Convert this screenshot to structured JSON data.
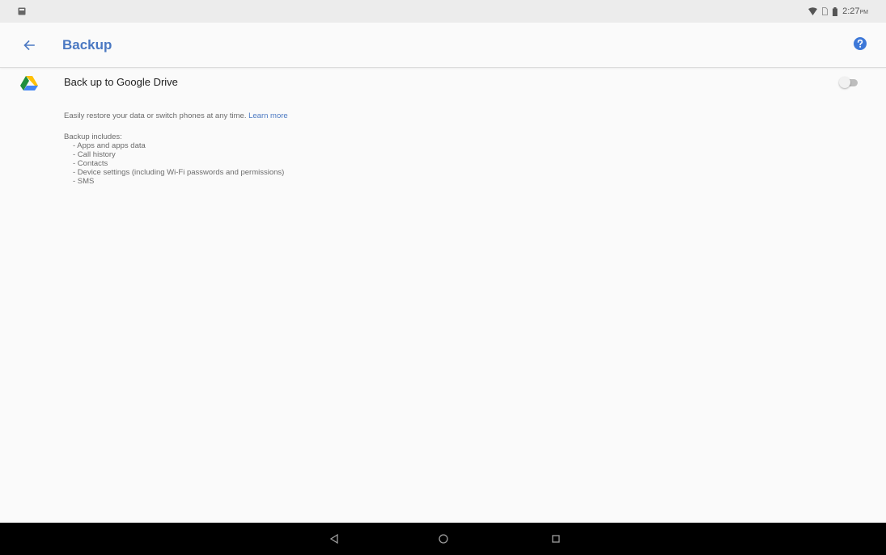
{
  "status_bar": {
    "time": "2:27",
    "time_suffix": "PM",
    "icons": [
      "notification-icon",
      "wifi-icon",
      "sim-icon",
      "battery-icon"
    ]
  },
  "toolbar": {
    "title": "Backup",
    "back_icon": "arrow-back-icon",
    "help_icon": "help-icon"
  },
  "backup_setting": {
    "icon": "google-drive-icon",
    "title": "Back up to Google Drive",
    "toggle_on": false,
    "description": "Easily restore your data or switch phones at any time.",
    "learn_more": "Learn more",
    "includes_header": "Backup includes:",
    "includes": [
      "- Apps and apps data",
      "- Call history",
      "- Contacts",
      "- Device settings (including Wi-Fi passwords and permissions)",
      "- SMS"
    ]
  },
  "colors": {
    "accent": "#4a78c2",
    "background": "#fafafa",
    "status_bar": "#ececec",
    "nav_bar": "#000000"
  },
  "nav_bar": {
    "buttons": [
      "back-triangle-icon",
      "home-circle-icon",
      "recents-square-icon"
    ]
  }
}
